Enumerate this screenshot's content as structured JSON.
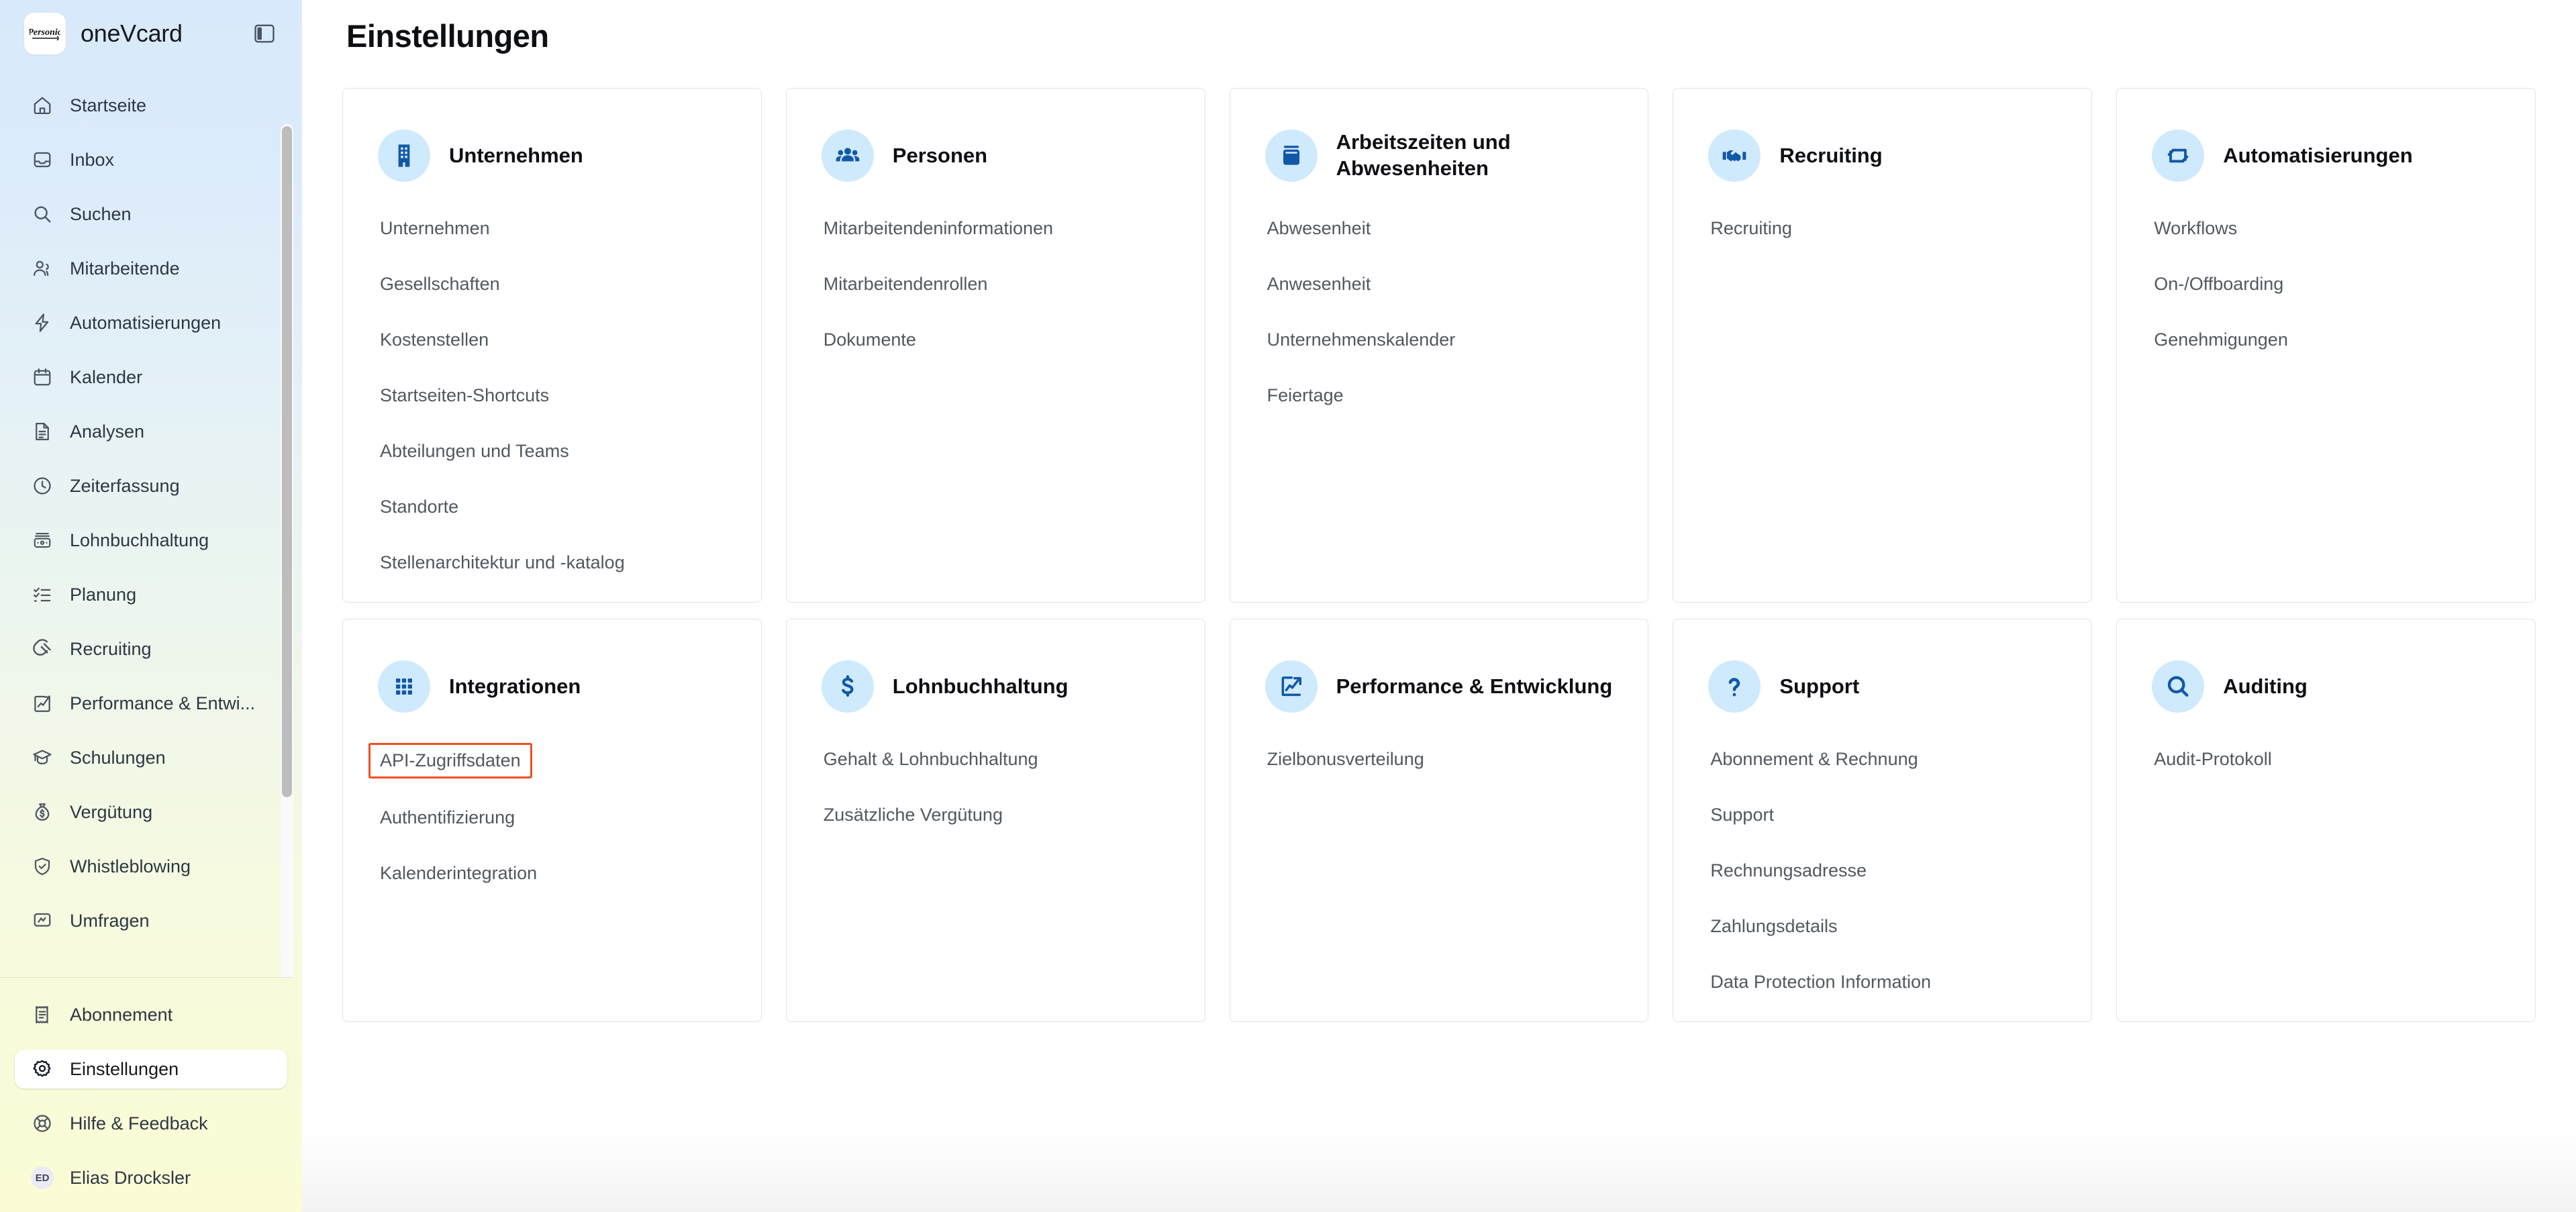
{
  "sidebar": {
    "brand": {
      "name": "oneVcard",
      "logo_text": "Personio",
      "logo_icon": "personio-logo"
    },
    "toggle_icon": "sidebar-toggle-icon",
    "nav_items": [
      {
        "label": "Startseite",
        "icon": "home-icon"
      },
      {
        "label": "Inbox",
        "icon": "inbox-icon"
      },
      {
        "label": "Suchen",
        "icon": "search-icon"
      },
      {
        "label": "Mitarbeitende",
        "icon": "users-icon"
      },
      {
        "label": "Automatisierungen",
        "icon": "lightning-icon"
      },
      {
        "label": "Kalender",
        "icon": "calendar-icon"
      },
      {
        "label": "Analysen",
        "icon": "document-chart-icon"
      },
      {
        "label": "Zeiterfassung",
        "icon": "clock-icon"
      },
      {
        "label": "Lohnbuchhaltung",
        "icon": "money-card-icon"
      },
      {
        "label": "Planung",
        "icon": "checklist-icon"
      },
      {
        "label": "Recruiting",
        "icon": "magnet-icon"
      },
      {
        "label": "Performance & Entwi...",
        "icon": "chart-up-icon"
      },
      {
        "label": "Schulungen",
        "icon": "graduation-cap-icon"
      },
      {
        "label": "Vergütung",
        "icon": "money-bag-icon"
      },
      {
        "label": "Whistleblowing",
        "icon": "shield-check-icon"
      },
      {
        "label": "Umfragen",
        "icon": "survey-icon"
      }
    ],
    "bottom_items": [
      {
        "label": "Abonnement",
        "icon": "receipt-icon",
        "active": false
      },
      {
        "label": "Einstellungen",
        "icon": "gear-icon",
        "active": true
      },
      {
        "label": "Hilfe & Feedback",
        "icon": "lifebuoy-icon",
        "active": false
      }
    ],
    "user": {
      "name": "Elias Drocksler",
      "initials": "ED"
    }
  },
  "main": {
    "title": "Einstellungen",
    "cards": [
      {
        "title": "Unternehmen",
        "icon": "building-icon",
        "links": [
          "Unternehmen",
          "Gesellschaften",
          "Kostenstellen",
          "Startseiten-Shortcuts",
          "Abteilungen und Teams",
          "Standorte",
          "Stellenarchitektur und -katalog"
        ]
      },
      {
        "title": "Personen",
        "icon": "people-group-icon",
        "links": [
          "Mitarbeitendeninformationen",
          "Mitarbeitendenrollen",
          "Dokumente"
        ]
      },
      {
        "title": "Arbeitszeiten und Abwesenheiten",
        "icon": "calendar-filled-icon",
        "links": [
          "Abwesenheit",
          "Anwesenheit",
          "Unternehmenskalender",
          "Feiertage"
        ]
      },
      {
        "title": "Recruiting",
        "icon": "handshake-icon",
        "links": [
          "Recruiting"
        ]
      },
      {
        "title": "Automatisierungen",
        "icon": "repeat-icon",
        "links": [
          "Workflows",
          "On-/Offboarding",
          "Genehmigungen"
        ]
      },
      {
        "title": "Integrationen",
        "icon": "grid-dots-icon",
        "links": [
          "API-Zugriffsdaten",
          "Authentifizierung",
          "Kalenderintegration"
        ],
        "highlight_link": "API-Zugriffsdaten"
      },
      {
        "title": "Lohnbuchhaltung",
        "icon": "dollar-icon",
        "links": [
          "Gehalt & Lohnbuchhaltung",
          "Zusätzliche Vergütung"
        ]
      },
      {
        "title": "Performance & Entwicklung",
        "icon": "chart-up-filled-icon",
        "links": [
          "Zielbonusverteilung"
        ]
      },
      {
        "title": "Support",
        "icon": "question-mark-icon",
        "links": [
          "Abonnement & Rechnung",
          "Support",
          "Rechnungsadresse",
          "Zahlungsdetails",
          "Data Protection Information"
        ]
      },
      {
        "title": "Auditing",
        "icon": "magnifier-icon",
        "links": [
          "Audit-Protokoll"
        ]
      }
    ]
  },
  "colors": {
    "highlight": "#F04E23",
    "badge_bg": "#CFEAFD",
    "badge_icon": "#1258A8",
    "sidebar_top": "#D8E9FB",
    "sidebar_bottom": "#FBFCD6"
  }
}
